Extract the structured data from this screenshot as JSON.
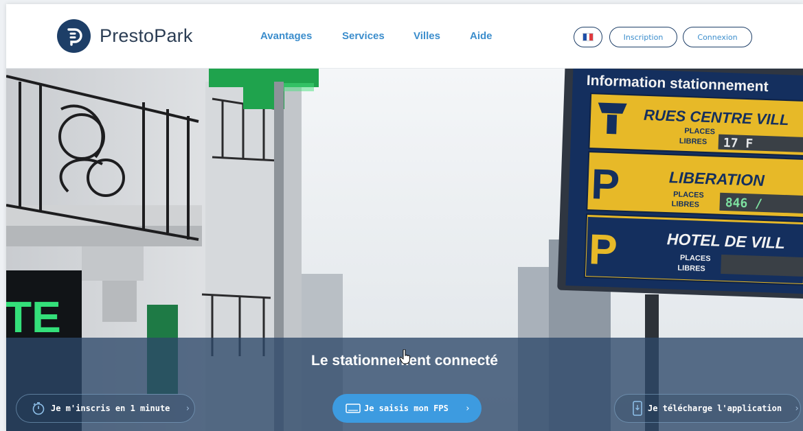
{
  "brand": {
    "name": "PrestoPark"
  },
  "nav": {
    "items": [
      {
        "label": "Avantages"
      },
      {
        "label": "Services"
      },
      {
        "label": "Villes"
      },
      {
        "label": "Aide"
      }
    ]
  },
  "header_buttons": {
    "language_icon": "french-flag-icon",
    "signup_label": "Inscription",
    "login_label": "Connexion"
  },
  "hero": {
    "tagline": "Le stationnement connecté",
    "sign": {
      "title": "Information stationnement",
      "rows": [
        {
          "letter": "",
          "name": "RUES CENTRE VILL",
          "places": "PLACES",
          "free": "LIBRES",
          "count": "17 F"
        },
        {
          "letter": "P",
          "name": "LIBERATION",
          "places": "PLACES",
          "free": "LIBRES",
          "count": "846 /"
        },
        {
          "letter": "P",
          "name": "HOTEL DE VILL",
          "places": "PLACES",
          "free": "LIBRES",
          "count": ""
        }
      ]
    },
    "pharmacy_sign": "TE"
  },
  "cta": {
    "signup": {
      "label": "Je m'inscris en 1 minute",
      "icon": "stopwatch-icon"
    },
    "fps": {
      "label": "Je saisis mon FPS",
      "icon": "tablet-icon"
    },
    "app": {
      "label": "Je télécharge l'application",
      "icon": "smartphone-icon"
    },
    "chevron": "›"
  },
  "colors": {
    "navy": "#1d3e67",
    "accent_blue": "#3b8dcc",
    "cta_blue": "#3d9be0",
    "sign_yellow": "#e7b928",
    "pharmacy_green": "#2fd16a"
  }
}
